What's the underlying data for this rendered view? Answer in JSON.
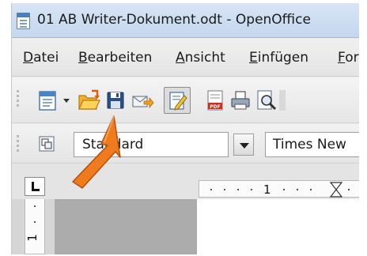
{
  "window": {
    "title": "01 AB Writer-Dokument.odt - OpenOffice"
  },
  "menubar": {
    "items": [
      {
        "accel": "D",
        "rest": "atei"
      },
      {
        "accel": "B",
        "rest": "earbeiten"
      },
      {
        "accel": "A",
        "rest": "nsicht"
      },
      {
        "accel": "E",
        "rest": "infügen"
      },
      {
        "accel": "F",
        "rest": "or"
      }
    ]
  },
  "toolbar": {
    "icons": [
      "new-document-icon",
      "dropdown-arrow-icon",
      "open-folder-icon",
      "save-icon",
      "send-email-icon",
      "edit-mode-icon",
      "export-pdf-icon",
      "print-icon",
      "page-preview-icon"
    ]
  },
  "formatting": {
    "paragraph_style": "Standard",
    "font_name": "Times New"
  },
  "ruler": {
    "horizontal_label": "1",
    "vertical_label": "1"
  },
  "annotation": {
    "arrow_color": "#f07a1e"
  }
}
